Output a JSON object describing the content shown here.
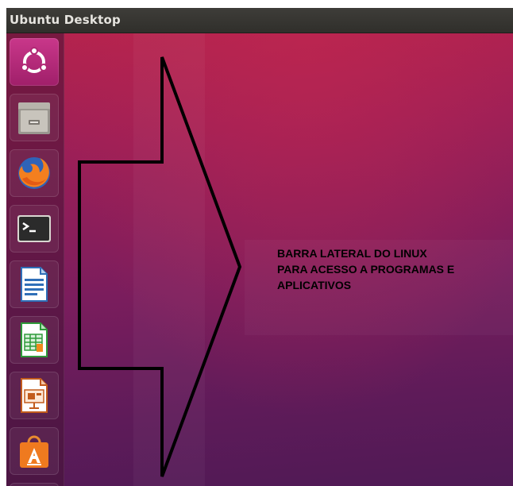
{
  "window": {
    "title": "Ubuntu Desktop"
  },
  "annotation": {
    "text": "BARRA LATERAL DO LINUX\nPARA ACESSO A PROGRAMAS E\nAPLICATIVOS"
  },
  "launcher": {
    "items": [
      {
        "icon": "ubuntu-dash-icon"
      },
      {
        "icon": "files-icon"
      },
      {
        "icon": "firefox-icon"
      },
      {
        "icon": "terminal-icon"
      },
      {
        "icon": "libreoffice-writer-icon"
      },
      {
        "icon": "libreoffice-calc-icon"
      },
      {
        "icon": "libreoffice-impress-icon"
      },
      {
        "icon": "software-center-icon"
      }
    ]
  },
  "colors": {
    "desktop_top": "#b5234d",
    "desktop_bottom": "#4f1a55",
    "topbar": "#3a3935",
    "annotation_text": "#000000",
    "arrow_stroke": "#000000"
  }
}
